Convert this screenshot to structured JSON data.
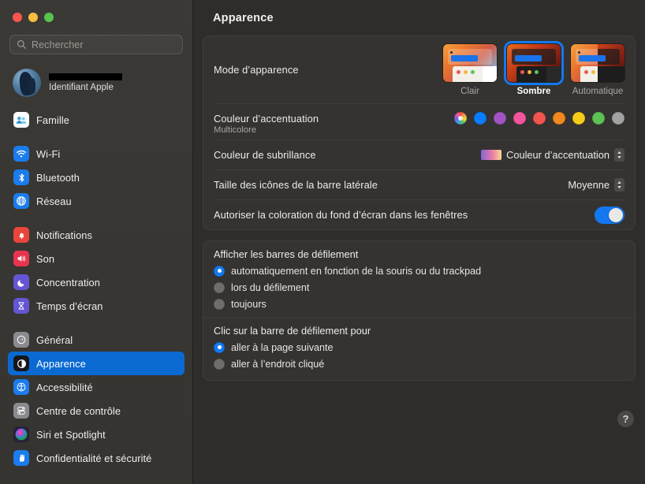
{
  "window": {
    "traffic_lights": [
      "close",
      "minimize",
      "zoom"
    ]
  },
  "sidebar": {
    "search": {
      "placeholder": "Rechercher",
      "icon": "search-icon"
    },
    "account": {
      "name_redacted": true,
      "subtitle": "Identifiant Apple"
    },
    "groups": [
      {
        "items": [
          {
            "label": "Famille",
            "icon": "family-icon",
            "color": "#ffffff",
            "selected": false
          }
        ]
      },
      {
        "items": [
          {
            "label": "Wi-Fi",
            "icon": "wifi-icon",
            "color": "#1a7ced",
            "selected": false
          },
          {
            "label": "Bluetooth",
            "icon": "bluetooth-icon",
            "color": "#1a7ced",
            "selected": false
          },
          {
            "label": "Réseau",
            "icon": "network-icon",
            "color": "#1a7ced",
            "selected": false
          }
        ]
      },
      {
        "items": [
          {
            "label": "Notifications",
            "icon": "notifications-icon",
            "color": "#e8463c",
            "selected": false
          },
          {
            "label": "Son",
            "icon": "sound-icon",
            "color": "#e8354f",
            "selected": false
          },
          {
            "label": "Concentration",
            "icon": "focus-icon",
            "color": "#6455d4",
            "selected": false
          },
          {
            "label": "Temps d’écran",
            "icon": "screen-time-icon",
            "color": "#6455d4",
            "selected": false
          }
        ]
      },
      {
        "items": [
          {
            "label": "Général",
            "icon": "general-icon",
            "color": "#8b8b8f",
            "selected": false
          },
          {
            "label": "Apparence",
            "icon": "appearance-icon",
            "color": "#17161a",
            "selected": true
          },
          {
            "label": "Accessibilité",
            "icon": "accessibility-icon",
            "color": "#1a7ced",
            "selected": false
          },
          {
            "label": "Centre de contrôle",
            "icon": "control-center-icon",
            "color": "#8b8b8f",
            "selected": false
          },
          {
            "label": "Siri et Spotlight",
            "icon": "siri-icon",
            "color": "#3d2b56",
            "selected": false
          },
          {
            "label": "Confidentialité et sécurité",
            "icon": "privacy-icon",
            "color": "#1a7ced",
            "selected": false
          }
        ]
      }
    ]
  },
  "main": {
    "title": "Apparence",
    "appearance_mode": {
      "label": "Mode d’apparence",
      "options": [
        {
          "label": "Clair",
          "value": "light",
          "selected": false
        },
        {
          "label": "Sombre",
          "value": "dark",
          "selected": true
        },
        {
          "label": "Automatique",
          "value": "auto",
          "selected": false
        }
      ]
    },
    "accent_color": {
      "label": "Couleur d’accentuation",
      "caption": "Multicolore",
      "swatches": [
        {
          "name": "multicolore",
          "color": "multicolor",
          "selected": true
        },
        {
          "name": "bleu",
          "color": "#0a7cff",
          "selected": false
        },
        {
          "name": "violet",
          "color": "#a153c4",
          "selected": false
        },
        {
          "name": "rose",
          "color": "#f2549d",
          "selected": false
        },
        {
          "name": "rouge",
          "color": "#f2554d",
          "selected": false
        },
        {
          "name": "orange",
          "color": "#f2881e",
          "selected": false
        },
        {
          "name": "jaune",
          "color": "#f7cc18",
          "selected": false
        },
        {
          "name": "vert",
          "color": "#5cc254",
          "selected": false
        },
        {
          "name": "graphite",
          "color": "#a2a2a2",
          "selected": false
        }
      ]
    },
    "highlight_color": {
      "label": "Couleur de subrillance",
      "value": "Couleur d’accentuation",
      "swatch_gradient": "#7b6ad0 → #f8d99a"
    },
    "sidebar_icon_size": {
      "label": "Taille des icônes de la barre latérale",
      "value": "Moyenne"
    },
    "wallpaper_tinting": {
      "label": "Autoriser la coloration du fond d’écran dans les fenêtres",
      "enabled": true
    },
    "show_scroll_bars": {
      "title": "Afficher les barres de défilement",
      "options": [
        {
          "label": "automatiquement en fonction de la souris ou du trackpad",
          "selected": true
        },
        {
          "label": "lors du défilement",
          "selected": false
        },
        {
          "label": "toujours",
          "selected": false
        }
      ]
    },
    "click_scroll_bar": {
      "title": "Clic sur la barre de défilement pour",
      "options": [
        {
          "label": "aller à la page suivante",
          "selected": true
        },
        {
          "label": "aller à l’endroit cliqué",
          "selected": false
        }
      ]
    },
    "help_button": {
      "label": "?"
    }
  },
  "colors": {
    "accent_blue": "#1479f0",
    "selected_row": "#0a6ad2",
    "sidebar_bg": "#393733",
    "content_bg": "#2e2d2c",
    "card_bg": "#343331"
  }
}
